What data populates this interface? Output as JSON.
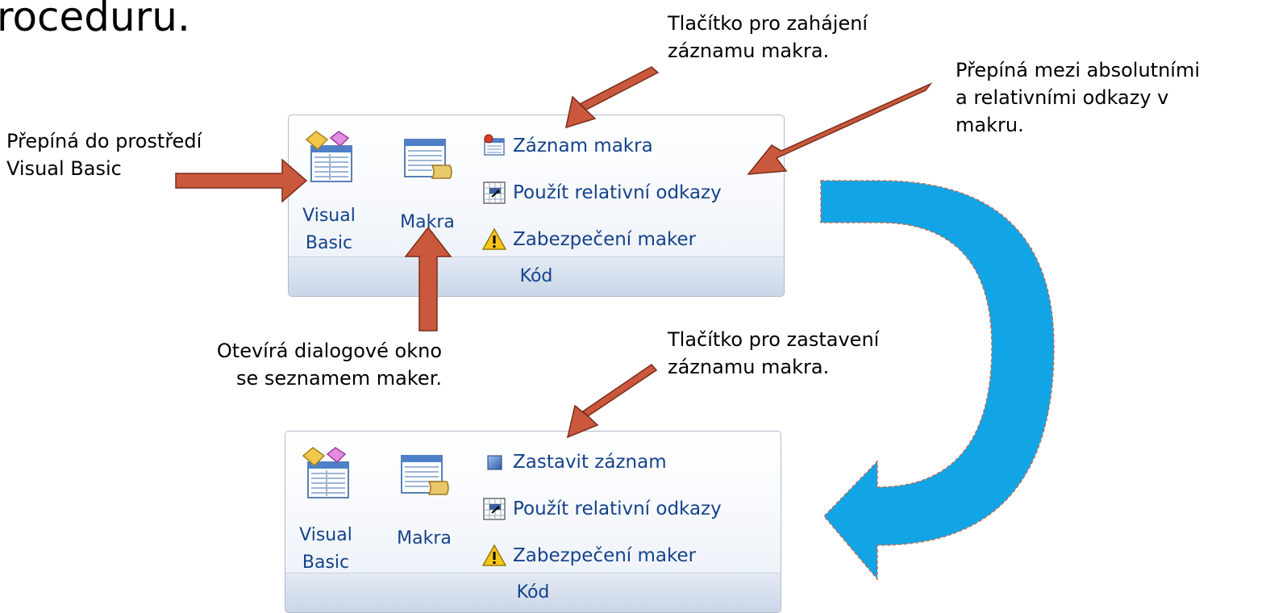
{
  "slide": {
    "top_text": "roceduru.",
    "annotations": {
      "start_record": [
        "Tlačítko pro zahájení",
        "záznamu makra."
      ],
      "relative_refs": [
        "Přepíná mezi absolutními",
        "a relativními odkazy v",
        "makru."
      ],
      "visual_basic": [
        "Přepíná do prostředí",
        "Visual Basic"
      ],
      "macros_dialog": [
        "Otevírá dialogové okno",
        "se seznamem maker."
      ],
      "stop_record": [
        "Tlačítko pro zastavení",
        "záznamu makra."
      ]
    }
  },
  "ribbon_before": {
    "group_label": "Kód",
    "visual_basic": [
      "Visual",
      "Basic"
    ],
    "macros": "Makra",
    "record_macro": "Záznam makra",
    "relative_refs": "Použít relativní odkazy",
    "macro_security": "Zabezpečení maker"
  },
  "ribbon_after": {
    "group_label": "Kód",
    "visual_basic": [
      "Visual",
      "Basic"
    ],
    "macros": "Makra",
    "stop_record": "Zastavit záznam",
    "relative_refs": "Použít relativní odkazy",
    "macro_security": "Zabezpečení maker"
  },
  "colors": {
    "annotation_arrow": "#c9583c",
    "flow_arrow": "#12a5e6",
    "ribbon_text": "#15428b"
  }
}
